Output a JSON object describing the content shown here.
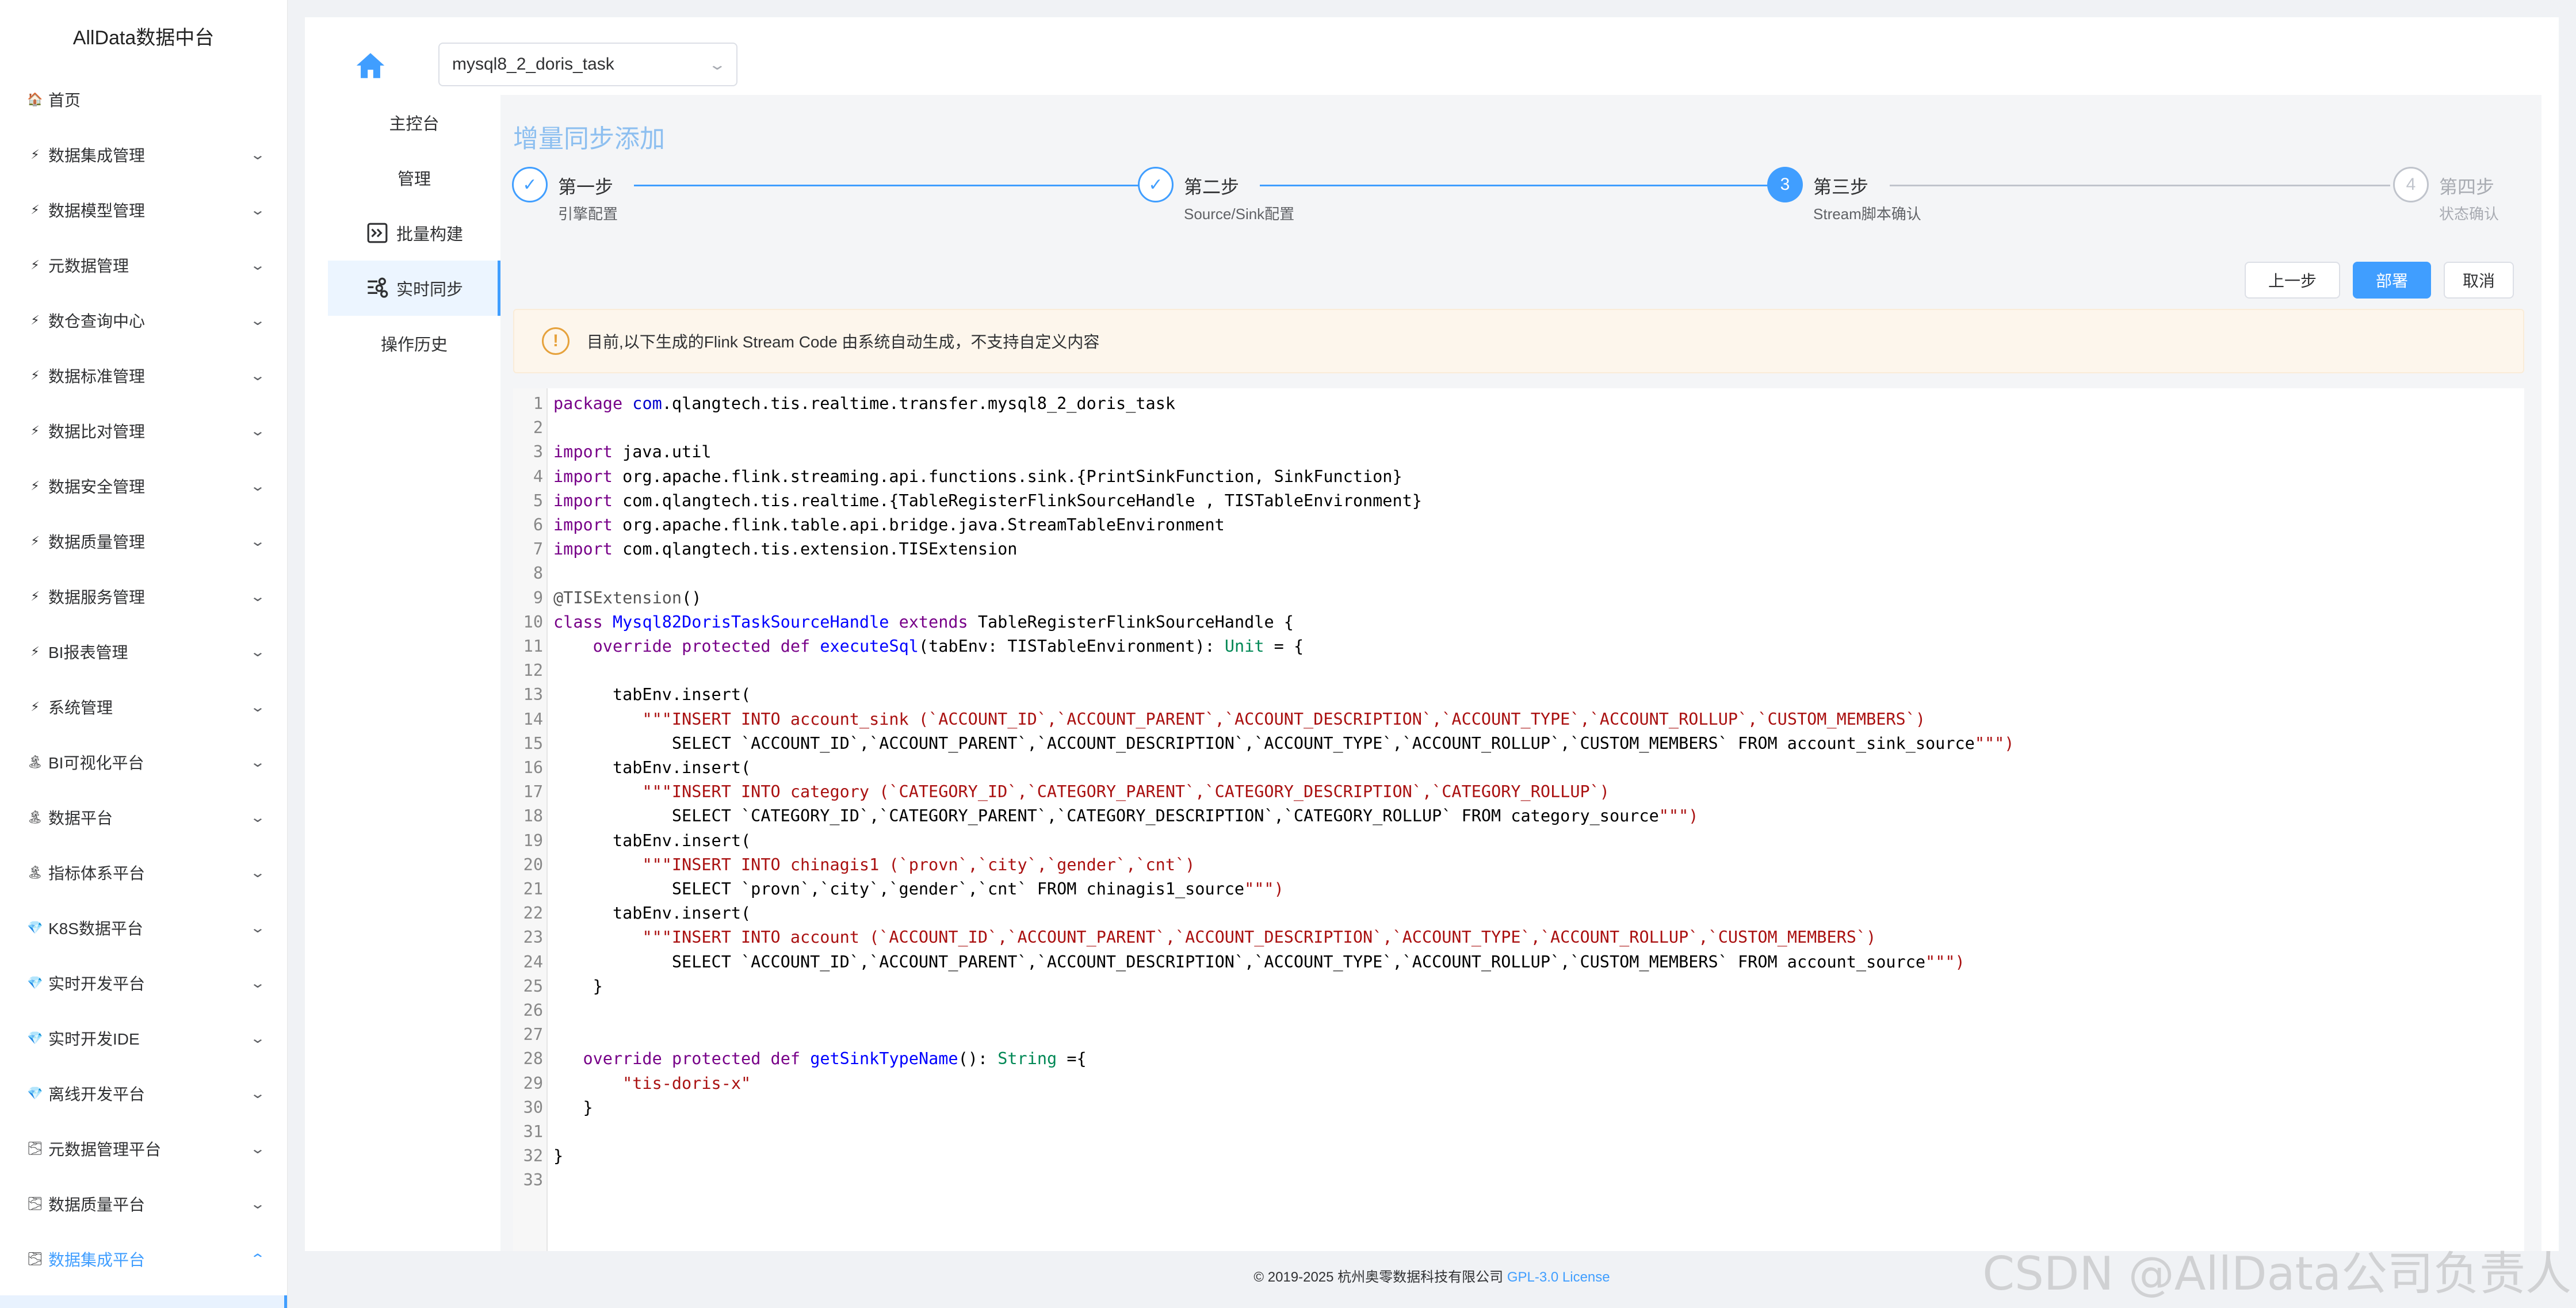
{
  "brand": "AllData数据中台",
  "sidebar": {
    "items": [
      {
        "icon": "🏠",
        "icon_name": "home-emoji-icon",
        "label": "首页",
        "has_chevron": false
      },
      {
        "icon": "⚡",
        "icon_name": "lightning-icon",
        "label": "数据集成管理",
        "has_chevron": true
      },
      {
        "icon": "⚡",
        "icon_name": "lightning-icon",
        "label": "数据模型管理",
        "has_chevron": true
      },
      {
        "icon": "⚡",
        "icon_name": "lightning-icon",
        "label": "元数据管理",
        "has_chevron": true
      },
      {
        "icon": "⚡",
        "icon_name": "lightning-icon",
        "label": "数仓查询中心",
        "has_chevron": true
      },
      {
        "icon": "⚡",
        "icon_name": "lightning-icon",
        "label": "数据标准管理",
        "has_chevron": true
      },
      {
        "icon": "⚡",
        "icon_name": "lightning-icon",
        "label": "数据比对管理",
        "has_chevron": true
      },
      {
        "icon": "⚡",
        "icon_name": "lightning-icon",
        "label": "数据安全管理",
        "has_chevron": true
      },
      {
        "icon": "⚡",
        "icon_name": "lightning-icon",
        "label": "数据质量管理",
        "has_chevron": true
      },
      {
        "icon": "⚡",
        "icon_name": "lightning-icon",
        "label": "数据服务管理",
        "has_chevron": true
      },
      {
        "icon": "⚡",
        "icon_name": "lightning-icon",
        "label": "BI报表管理",
        "has_chevron": true
      },
      {
        "icon": "⚡",
        "icon_name": "lightning-icon",
        "label": "系统管理",
        "has_chevron": true
      },
      {
        "icon": "🏝",
        "icon_name": "island-icon",
        "label": "BI可视化平台",
        "has_chevron": true
      },
      {
        "icon": "🏝",
        "icon_name": "island-icon",
        "label": "数据平台",
        "has_chevron": true
      },
      {
        "icon": "🏝",
        "icon_name": "island-icon",
        "label": "指标体系平台",
        "has_chevron": true
      },
      {
        "icon": "💎",
        "icon_name": "gem-icon",
        "label": "K8S数据平台",
        "has_chevron": true
      },
      {
        "icon": "💎",
        "icon_name": "gem-icon",
        "label": "实时开发平台",
        "has_chevron": true
      },
      {
        "icon": "💎",
        "icon_name": "gem-icon",
        "label": "实时开发IDE",
        "has_chevron": true
      },
      {
        "icon": "💎",
        "icon_name": "gem-icon",
        "label": "离线开发平台",
        "has_chevron": true
      },
      {
        "icon": "🌫",
        "icon_name": "cloud-icon",
        "label": "元数据管理平台",
        "has_chevron": true
      },
      {
        "icon": "🌫",
        "icon_name": "cloud-icon",
        "label": "数据质量平台",
        "has_chevron": true
      },
      {
        "icon": "🌫",
        "icon_name": "cloud-icon",
        "label": "数据集成平台",
        "has_chevron": true,
        "active": true
      }
    ],
    "chevron_down": "⌄",
    "chevron_up": "⌃"
  },
  "topbar": {
    "task_select_value": "mysql8_2_doris_task",
    "chevron": "⌄"
  },
  "inner_menu": [
    {
      "label": "主控台",
      "icon": ""
    },
    {
      "label": "管理",
      "icon": ""
    },
    {
      "label": "批量构建",
      "icon": "batch-build-icon"
    },
    {
      "label": "实时同步",
      "icon": "realtime-sync-icon",
      "active": true
    },
    {
      "label": "操作历史",
      "icon": ""
    }
  ],
  "page_title": "增量同步添加",
  "steps": [
    {
      "status": "done",
      "title": "第一步",
      "desc": "引擎配置",
      "mark": "✓"
    },
    {
      "status": "done",
      "title": "第二步",
      "desc": "Source/Sink配置",
      "mark": "✓"
    },
    {
      "status": "current",
      "title": "第三步",
      "desc": "Stream脚本确认",
      "mark": "3"
    },
    {
      "status": "wait",
      "title": "第四步",
      "desc": "状态确认",
      "mark": "4"
    }
  ],
  "buttons": {
    "prev": "上一步",
    "deploy": "部署",
    "cancel": "取消"
  },
  "alert": {
    "icon": "!",
    "text": "目前,以下生成的Flink Stream Code 由系统自动生成，不支持自定义内容"
  },
  "code_lines": [
    "package com.qlangtech.tis.realtime.transfer.mysql8_2_doris_task",
    "",
    "import java.util",
    "import org.apache.flink.streaming.api.functions.sink.{PrintSinkFunction, SinkFunction}",
    "import com.qlangtech.tis.realtime.{TableRegisterFlinkSourceHandle , TISTableEnvironment}",
    "import org.apache.flink.table.api.bridge.java.StreamTableEnvironment",
    "import com.qlangtech.tis.extension.TISExtension",
    "",
    "@TISExtension()",
    "class Mysql82DorisTaskSourceHandle extends TableRegisterFlinkSourceHandle {",
    "    override protected def executeSql(tabEnv: TISTableEnvironment): Unit = {",
    "",
    "      tabEnv.insert(",
    "         \"\"\"INSERT INTO account_sink (`ACCOUNT_ID`,`ACCOUNT_PARENT`,`ACCOUNT_DESCRIPTION`,`ACCOUNT_TYPE`,`ACCOUNT_ROLLUP`,`CUSTOM_MEMBERS`)",
    "            SELECT `ACCOUNT_ID`,`ACCOUNT_PARENT`,`ACCOUNT_DESCRIPTION`,`ACCOUNT_TYPE`,`ACCOUNT_ROLLUP`,`CUSTOM_MEMBERS` FROM account_sink_source\"\"\")",
    "      tabEnv.insert(",
    "         \"\"\"INSERT INTO category (`CATEGORY_ID`,`CATEGORY_PARENT`,`CATEGORY_DESCRIPTION`,`CATEGORY_ROLLUP`)",
    "            SELECT `CATEGORY_ID`,`CATEGORY_PARENT`,`CATEGORY_DESCRIPTION`,`CATEGORY_ROLLUP` FROM category_source\"\"\")",
    "      tabEnv.insert(",
    "         \"\"\"INSERT INTO chinagis1 (`provn`,`city`,`gender`,`cnt`)",
    "            SELECT `provn`,`city`,`gender`,`cnt` FROM chinagis1_source\"\"\")",
    "      tabEnv.insert(",
    "         \"\"\"INSERT INTO account (`ACCOUNT_ID`,`ACCOUNT_PARENT`,`ACCOUNT_DESCRIPTION`,`ACCOUNT_TYPE`,`ACCOUNT_ROLLUP`,`CUSTOM_MEMBERS`)",
    "            SELECT `ACCOUNT_ID`,`ACCOUNT_PARENT`,`ACCOUNT_DESCRIPTION`,`ACCOUNT_TYPE`,`ACCOUNT_ROLLUP`,`CUSTOM_MEMBERS` FROM account_source\"\"\")",
    "    }",
    "",
    "",
    "   override protected def getSinkTypeName(): String ={",
    "       \"tis-doris-x\"",
    "   }",
    "",
    "}",
    ""
  ],
  "footer": {
    "text": "© 2019-2025 杭州奥零数据科技有限公司 ",
    "link": "GPL-3.0 License"
  },
  "watermark": "CSDN @AllData公司负责人",
  "colors": {
    "accent": "#409eff",
    "title": "#8dbff0",
    "warning": "#e6a23c",
    "alert_bg": "#fdf6ec"
  }
}
